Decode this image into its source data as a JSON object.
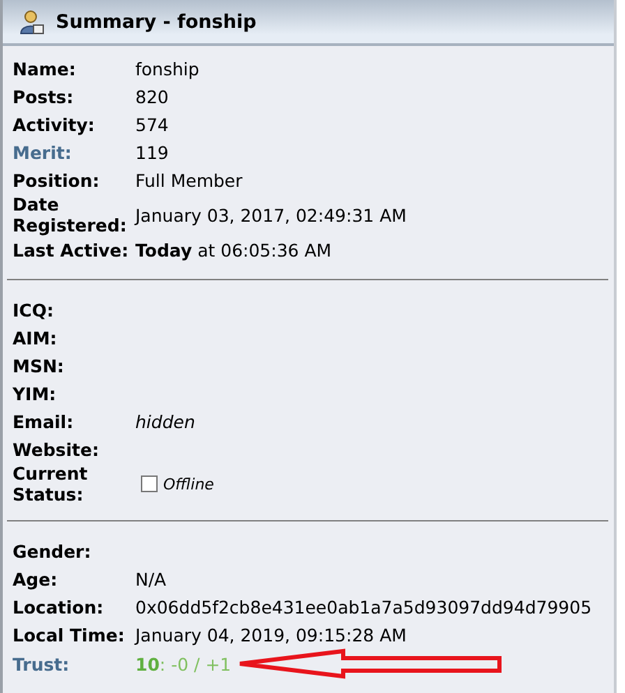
{
  "panel": {
    "title": "Summary - fonship"
  },
  "sections": [
    {
      "rows": [
        {
          "label": "Name:",
          "value": "fonship",
          "kind": "text",
          "link": false
        },
        {
          "label": "Posts:",
          "value": "820",
          "kind": "text",
          "link": false
        },
        {
          "label": "Activity:",
          "value": "574",
          "kind": "text",
          "link": false
        },
        {
          "label": "Merit:",
          "value": "119",
          "kind": "text",
          "link": true
        },
        {
          "label": "Position:",
          "value": "Full Member",
          "kind": "text",
          "link": false
        },
        {
          "label": "Date Registered:",
          "value": "January 03, 2017, 02:49:31 AM",
          "kind": "text",
          "link": false
        },
        {
          "label": "Last Active:",
          "value": "**Today** at 06:05:36 AM",
          "kind": "text",
          "link": false
        }
      ]
    },
    {
      "rows": [
        {
          "label": "ICQ:",
          "kind": "text",
          "link": false
        },
        {
          "label": "AIM:",
          "kind": "text",
          "link": false
        },
        {
          "label": "MSN:",
          "kind": "text",
          "link": false
        },
        {
          "label": "YIM:",
          "kind": "text",
          "link": false
        },
        {
          "label": "Email:",
          "value": "hidden",
          "kind": "note",
          "link": false
        },
        {
          "label": "Website:",
          "kind": "text",
          "link": false
        },
        {
          "label": "Current Status:",
          "value": "Offline",
          "kind": "status",
          "checked": false,
          "link": false
        }
      ]
    },
    {
      "rows": [
        {
          "label": "Gender:",
          "kind": "text",
          "link": false
        },
        {
          "label": "Age:",
          "value": "N/A",
          "kind": "text",
          "link": false
        },
        {
          "label": "Location:",
          "value": "0x06dd5f2cb8e431ee0ab1a7a5d93097dd94d79905",
          "kind": "text",
          "link": false
        },
        {
          "label": "Local Time:",
          "value": "January 04, 2019, 09:15:28 AM",
          "kind": "text",
          "link": false
        },
        {
          "label": "Trust:",
          "value": "**10**: -0 / +1",
          "kind": "trust",
          "link": true,
          "marked": true
        }
      ]
    }
  ]
}
